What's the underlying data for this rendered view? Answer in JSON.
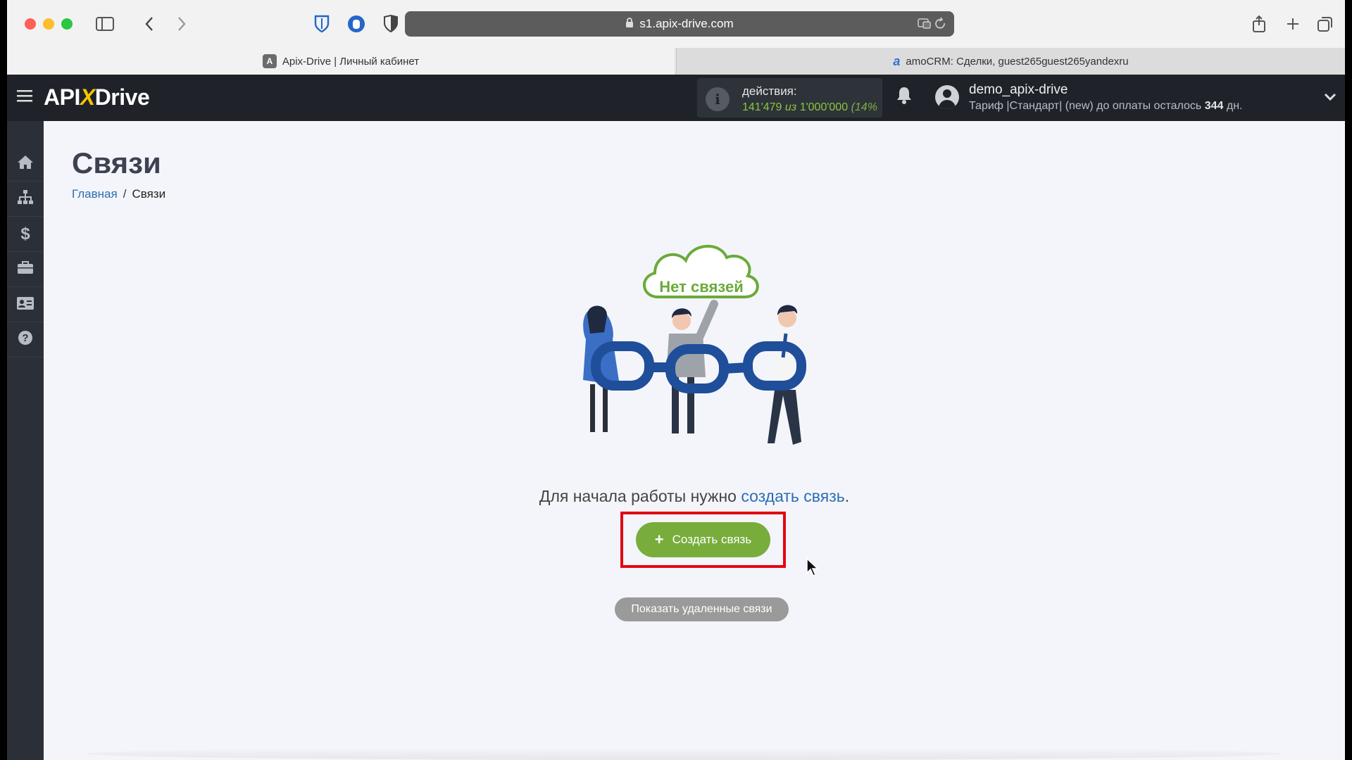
{
  "browser": {
    "url": "s1.apix-drive.com",
    "tabs": [
      {
        "label": "Apix-Drive | Личный кабинет",
        "favicon": "A",
        "active": true
      },
      {
        "label": "amoCRM: Сделки, guest265guest265yandexru",
        "favicon": "a",
        "active": false
      }
    ]
  },
  "header": {
    "logo_api": "API",
    "logo_x": "X",
    "logo_drive": "Drive",
    "actions_label": "действия:",
    "actions_used": "141'479",
    "actions_of": "из",
    "actions_total": "1'000'000",
    "actions_extra": "(14%",
    "username": "demo_apix-drive",
    "tariff_text": "Тариф |Стандарт| (new) до оплаты осталось",
    "days_left": "344",
    "days_unit": "дн."
  },
  "sidebar": {
    "items": [
      {
        "name": "home",
        "icon": "home-icon"
      },
      {
        "name": "connections",
        "icon": "sitemap-icon"
      },
      {
        "name": "billing",
        "icon": "dollar-icon"
      },
      {
        "name": "services",
        "icon": "briefcase-icon"
      },
      {
        "name": "contacts",
        "icon": "id-card-icon"
      },
      {
        "name": "help",
        "icon": "question-icon"
      }
    ]
  },
  "main": {
    "title": "Связи",
    "breadcrumb_home": "Главная",
    "breadcrumb_current": "Связи",
    "cloud_text": "Нет связей",
    "lead_text": "Для начала работы нужно ",
    "lead_link": "создать связь",
    "lead_end": ".",
    "create_button": "Создать связь",
    "deleted_button": "Показать удаленные связи"
  },
  "colors": {
    "accent_green": "#78ad3c",
    "link_blue": "#2c6db3",
    "highlight_red": "#e30613",
    "header_dark": "#1f2329",
    "logo_yellow": "#f5c400"
  }
}
